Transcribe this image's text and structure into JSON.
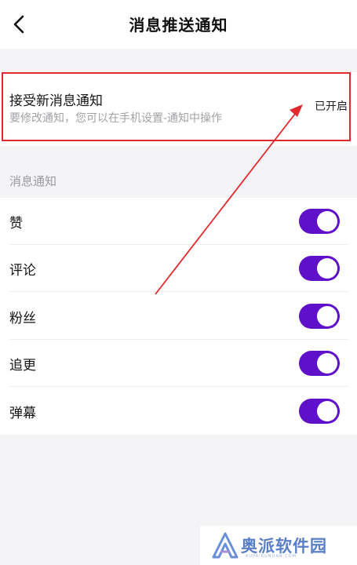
{
  "header": {
    "title": "消息推送通知",
    "back_icon": "chevron-left-icon"
  },
  "master_setting": {
    "title": "接受新消息通知",
    "subtitle": "要修改通知，您可以在手机设置-通知中操作",
    "status": "已开启",
    "highlight_color": "#e12a2e"
  },
  "section": {
    "label": "消息通知"
  },
  "toggles": [
    {
      "label": "赞",
      "on": true
    },
    {
      "label": "评论",
      "on": true
    },
    {
      "label": "粉丝",
      "on": true
    },
    {
      "label": "追更",
      "on": true
    },
    {
      "label": "弹幕",
      "on": true
    }
  ],
  "colors": {
    "toggle_on": "#5f10c9",
    "annotation": "#e12a2e",
    "background": "#f4f4f6"
  },
  "watermark": {
    "text": "奥派软件园",
    "sub": "AUPAIRUNJIAN.COM"
  }
}
